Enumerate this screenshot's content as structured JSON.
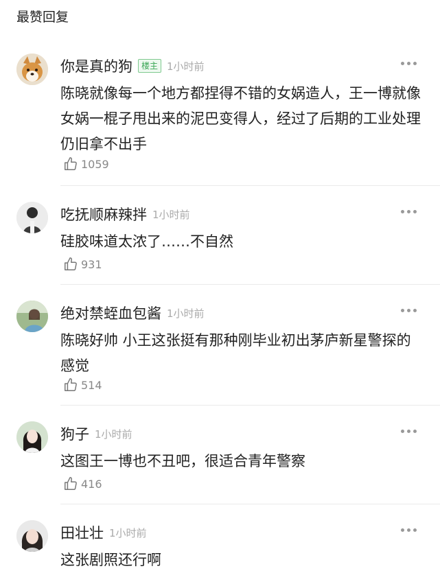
{
  "header": {
    "title": "最赞回复"
  },
  "colors": {
    "op_badge": "#3aa655",
    "divider": "#eaeaea",
    "muted": "#aaaaaa"
  },
  "comments": [
    {
      "name": "你是真的狗",
      "badge": "楼主",
      "time": "1小时前",
      "text": "陈晓就像每一个地方都捏得不错的女娲造人，王一博就像女娲一棍子甩出来的泥巴变得人，经过了后期的工业处理仍旧拿不出手",
      "likes": "1059",
      "avatar_icon": "corgi-dog-avatar"
    },
    {
      "name": "吃抚顺麻辣拌",
      "time": "1小时前",
      "text": "硅胶味道太浓了……不自然",
      "likes": "931",
      "avatar_icon": "person-avatar"
    },
    {
      "name": "绝对禁蛭血包酱",
      "time": "1小时前",
      "text": "陈晓好帅 小王这张挺有那种刚毕业初出茅庐新星警探的感觉",
      "likes": "514",
      "avatar_icon": "person-avatar"
    },
    {
      "name": "狗子",
      "time": "1小时前",
      "text": "这图王一博也不丑吧，很适合青年警察",
      "likes": "416",
      "avatar_icon": "person-avatar"
    },
    {
      "name": "田壮壮",
      "time": "1小时前",
      "text": "这张剧照还行啊",
      "avatar_icon": "person-avatar"
    }
  ]
}
